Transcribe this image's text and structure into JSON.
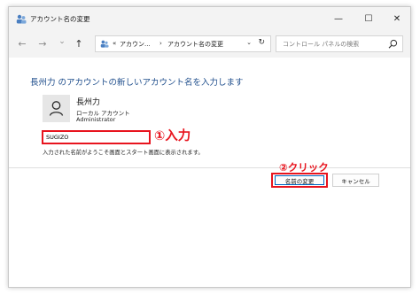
{
  "window": {
    "title": "アカウント名の変更",
    "minimize_glyph": "—",
    "maximize_glyph": "☐",
    "close_glyph": "✕"
  },
  "nav": {
    "back_glyph": "←",
    "forward_glyph": "→",
    "recent_glyph": "⌄",
    "up_glyph": "↑"
  },
  "address": {
    "prefix": "«",
    "crumb_1": "アカウン...",
    "separator": "›",
    "crumb_2": "アカウント名の変更",
    "dropdown_glyph": "⌄",
    "refresh_glyph": "↻"
  },
  "search": {
    "placeholder": "コントロール パネルの検索"
  },
  "main": {
    "heading": "長州力 のアカウントの新しいアカウント名を入力します",
    "user": {
      "name": "長州力",
      "type": "ローカル アカウント",
      "role": "Administrator"
    },
    "name_input_value": "SUGIZO",
    "info_text": "入力された名前がようこそ画面とスタート画面に表示されます。"
  },
  "annotations": {
    "step1": "①入力",
    "step2": "②クリック"
  },
  "buttons": {
    "rename": "名前の変更",
    "cancel": "キャンセル"
  },
  "colors": {
    "annotation_red": "#e8141e",
    "heading_blue": "#1f4e8c",
    "focus_blue": "#0067c0"
  }
}
